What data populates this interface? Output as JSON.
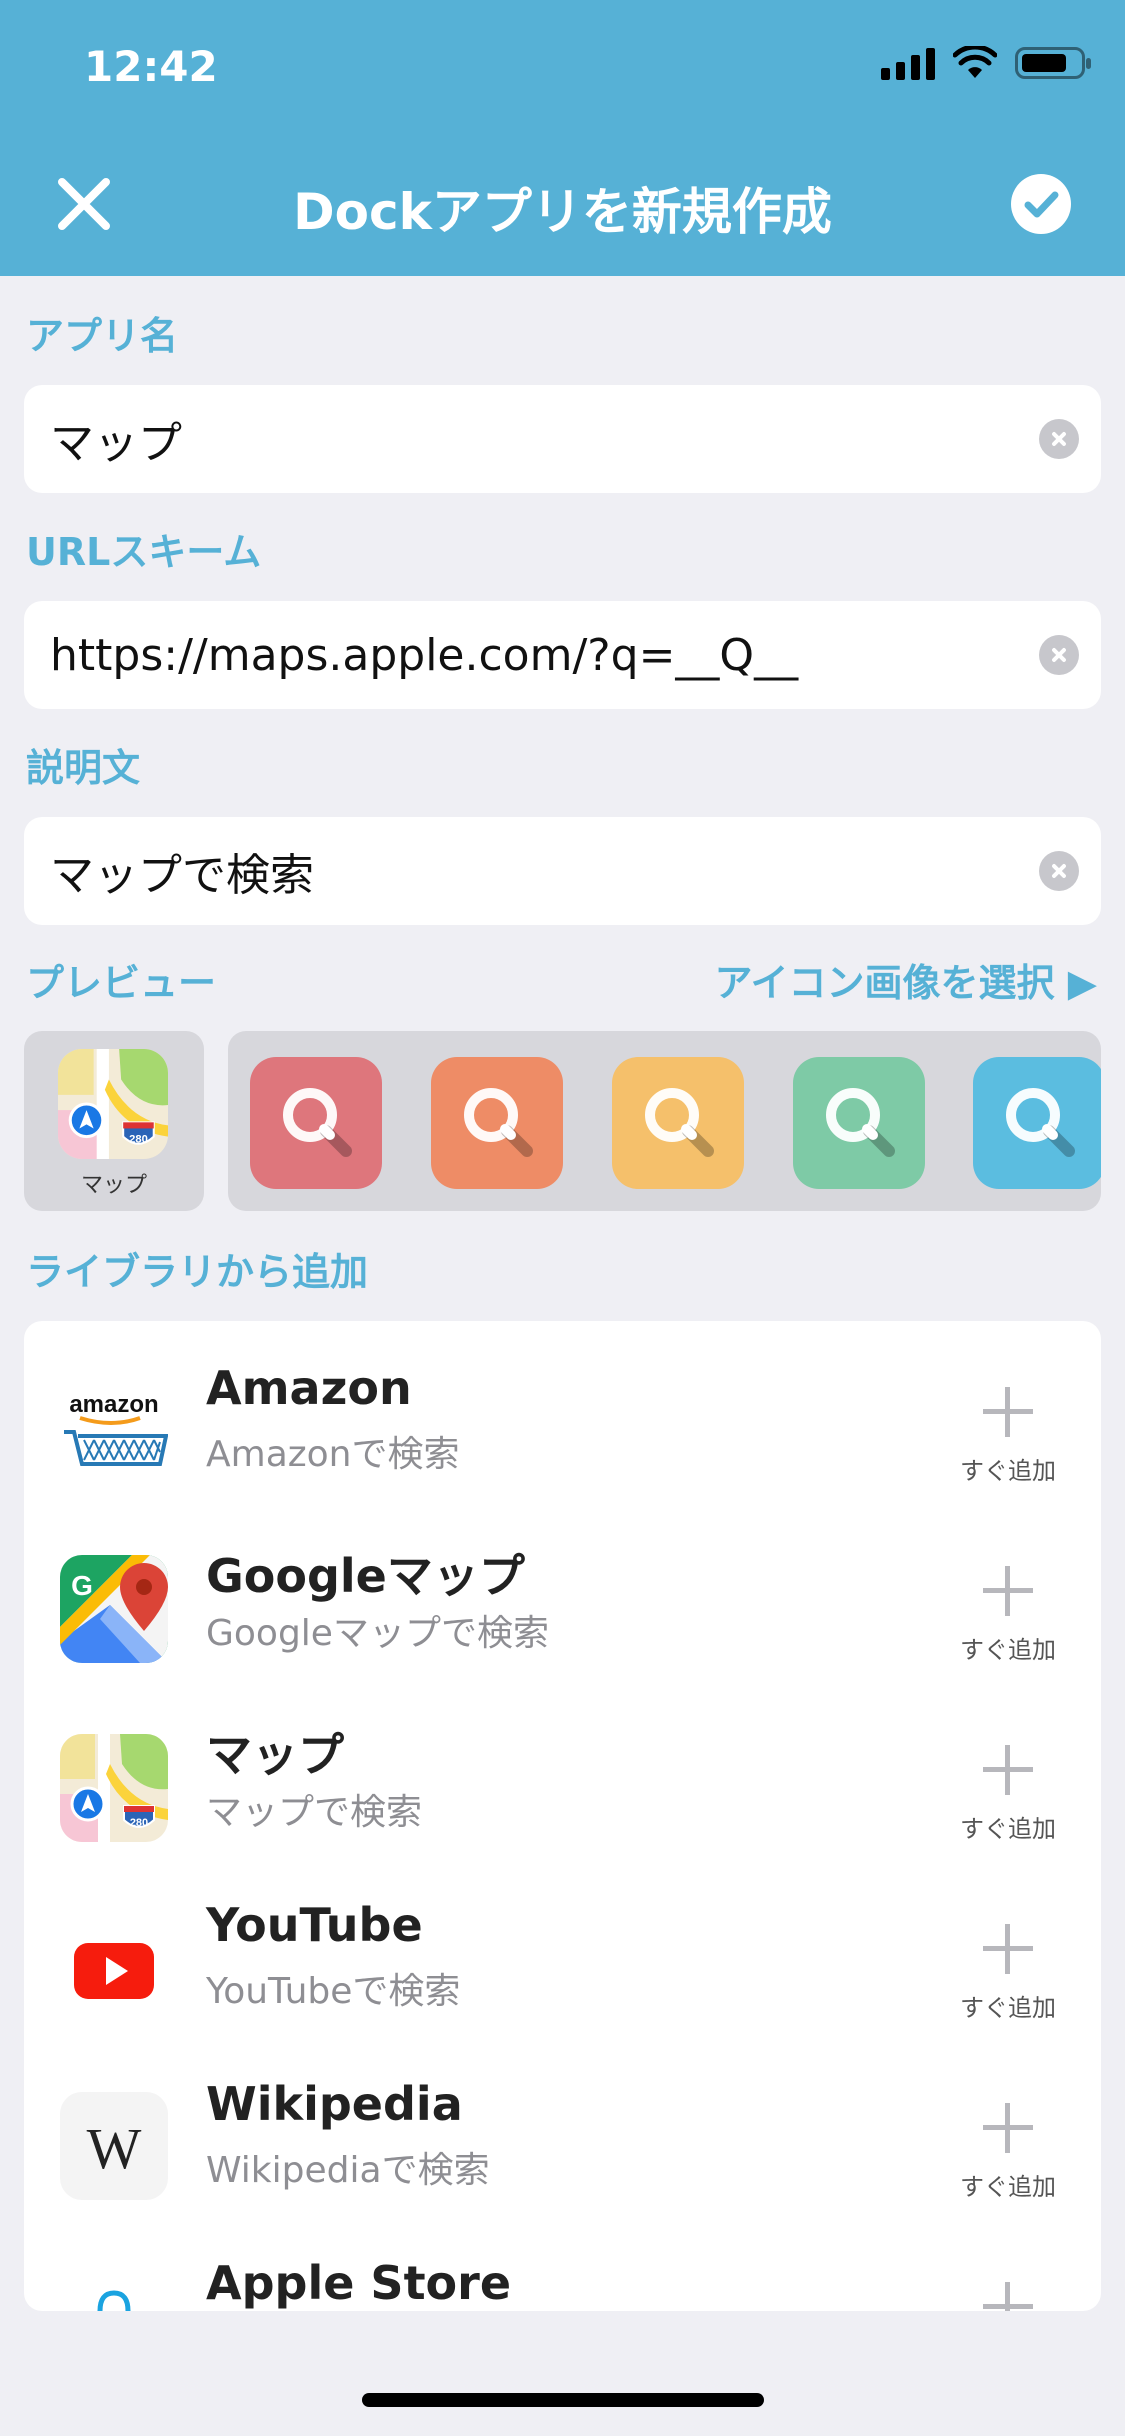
{
  "status_bar": {
    "time": "12:42"
  },
  "header": {
    "title": "Dockアプリを新規作成"
  },
  "form": {
    "app_name_label": "アプリ名",
    "app_name_value": "マップ",
    "url_label": "URLスキーム",
    "url_value": "https://maps.apple.com/?q=__Q__",
    "desc_label": "説明文",
    "desc_value": "マップで検索"
  },
  "preview": {
    "label": "プレビュー",
    "select_icon": "アイコン画像を選択 ▶",
    "icon_caption": "マップ",
    "swatch_colors": [
      "#de767c",
      "#ee8c66",
      "#f5c06b",
      "#7ecaa6",
      "#5bbde0"
    ]
  },
  "library": {
    "label": "ライブラリから追加",
    "add_label": "すぐ追加",
    "items": [
      {
        "name": "Amazon",
        "desc": "Amazonで検索"
      },
      {
        "name": "Googleマップ",
        "desc": "Googleマップで検索"
      },
      {
        "name": "マップ",
        "desc": "マップで検索"
      },
      {
        "name": "YouTube",
        "desc": "YouTubeで検索"
      },
      {
        "name": "Wikipedia",
        "desc": "Wikipediaで検索"
      },
      {
        "name": "Apple Store",
        "desc": ""
      }
    ]
  },
  "icons": {
    "amazon": "amazon",
    "amazon_logo_text": "amazon",
    "wikipedia_logo_text": "W",
    "maps_shield_text": "280"
  },
  "colors": {
    "accent": "#56b1d6",
    "background": "#efeff4"
  }
}
